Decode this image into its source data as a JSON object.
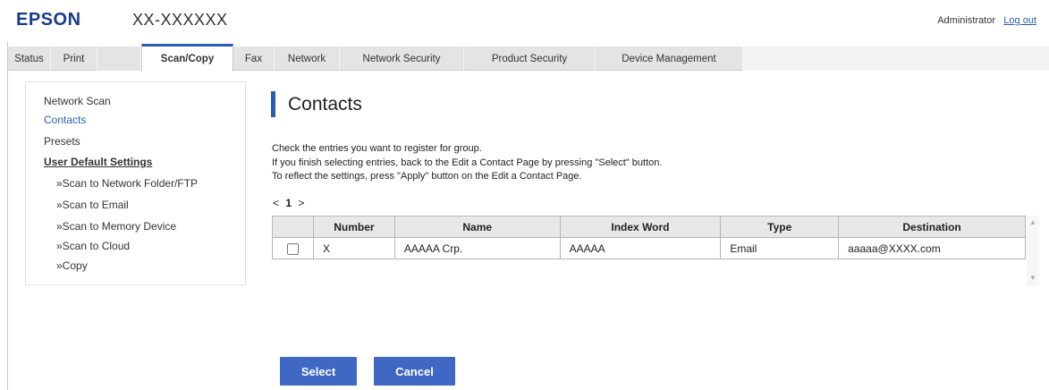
{
  "header": {
    "brand": "EPSON",
    "model": "XX-XXXXXX",
    "user": "Administrator",
    "logout": "Log out"
  },
  "tabs": [
    {
      "label": "Status"
    },
    {
      "label": "Print"
    },
    {
      "label": "Scan/Copy",
      "active": true
    },
    {
      "label": "Fax"
    },
    {
      "label": "Network"
    },
    {
      "label": "Network Security"
    },
    {
      "label": "Product Security"
    },
    {
      "label": "Device Management"
    }
  ],
  "sidebar": {
    "items": [
      {
        "label": "Network Scan"
      },
      {
        "label": "Contacts"
      },
      {
        "label": "Presets"
      },
      {
        "label": "User Default Settings"
      },
      {
        "label": "»Scan to Network Folder/FTP"
      },
      {
        "label": "»Scan to Email"
      },
      {
        "label": "»Scan to Memory Device"
      },
      {
        "label": "»Scan to Cloud"
      },
      {
        "label": "»Copy"
      }
    ]
  },
  "main": {
    "title": "Contacts",
    "description": [
      "Check the entries you want to register for group.",
      "If you finish selecting entries, back to the Edit a Contact Page by pressing \"Select\" button.",
      "To reflect the settings, press \"Apply\" button on the Edit a Contact Page."
    ],
    "pager": {
      "prev": "<",
      "current": "1",
      "next": ">"
    },
    "table": {
      "headers": [
        "",
        "Number",
        "Name",
        "Index Word",
        "Type",
        "Destination"
      ],
      "rows": [
        {
          "checked": false,
          "number": "X",
          "name": "AAAAA Crp.",
          "index_word": "AAAAA",
          "type": "Email",
          "destination": "aaaaa@XXXX.com"
        }
      ]
    },
    "buttons": {
      "select": "Select",
      "cancel": "Cancel"
    }
  },
  "colors": {
    "accent": "#2a5db0",
    "brand": "#1a3a8f",
    "button": "#3f67c4",
    "tab_bg": "#e4e4e4"
  }
}
